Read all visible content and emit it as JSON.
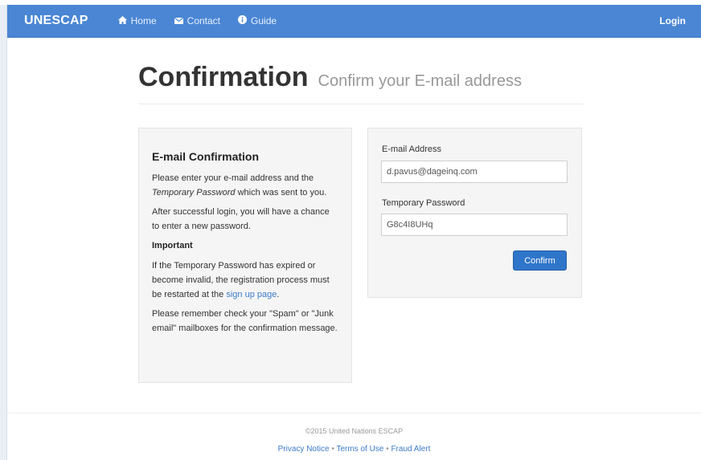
{
  "navbar": {
    "brand": "UNESCAP",
    "items": [
      {
        "label": "Home",
        "icon": "home-icon"
      },
      {
        "label": "Contact",
        "icon": "envelope-icon"
      },
      {
        "label": "Guide",
        "icon": "info-circle-icon"
      }
    ],
    "login": "Login",
    "background_color": "#4a86d4"
  },
  "header": {
    "title": "Confirmation",
    "subtitle": "Confirm your E-mail address"
  },
  "info_panel": {
    "title": "E-mail Confirmation",
    "p1_before": "Please enter your e-mail address and the ",
    "p1_em": "Temporary Password",
    "p1_after": " which was sent to you.",
    "p2": "After successful login, you will have a chance to enter a new password.",
    "important_heading": "Important",
    "p3_before": "If the Temporary Password has expired or become invalid, the registration process must be restarted at the ",
    "p3_link": "sign up page",
    "p3_after": ".",
    "p4": "Please remember check your \"Spam\" or \"Junk email\" mailboxes for the confirmation message."
  },
  "form": {
    "email_label": "E-mail Address",
    "email_value": "d.pavus@dageinq.com",
    "password_label": "Temporary Password",
    "password_value": "G8c4I8UHq",
    "confirm_label": "Confirm",
    "button_color": "#2f75c9"
  },
  "footer": {
    "copyright": "©2015 United Nations ESCAP",
    "links": [
      "Privacy Notice",
      "Terms of Use",
      "Fraud Alert"
    ],
    "separator": "•"
  }
}
